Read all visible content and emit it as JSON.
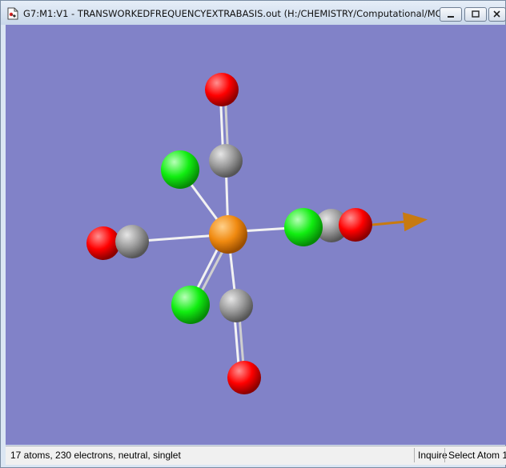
{
  "window": {
    "title": "G7:M1:V1 - TRANSWORKEDFREQUENCYEXTRABASIS.out (H:/CHEMISTRY/Computational/MOD..."
  },
  "controls": [
    "minimize-icon",
    "restore-icon",
    "close-icon"
  ],
  "viewport": {
    "background_color": "#8182c8",
    "atom_colors": {
      "metal": "#f08a10",
      "carbon": "#9a9a9a",
      "oxygen": "#ff0000",
      "chlorine": "#11ee11"
    },
    "vector_color": "#c87a10"
  },
  "status": {
    "summary": "17 atoms, 230 electrons, neutral, singlet",
    "mode": "Inquire",
    "action": "Select Atom 1"
  }
}
